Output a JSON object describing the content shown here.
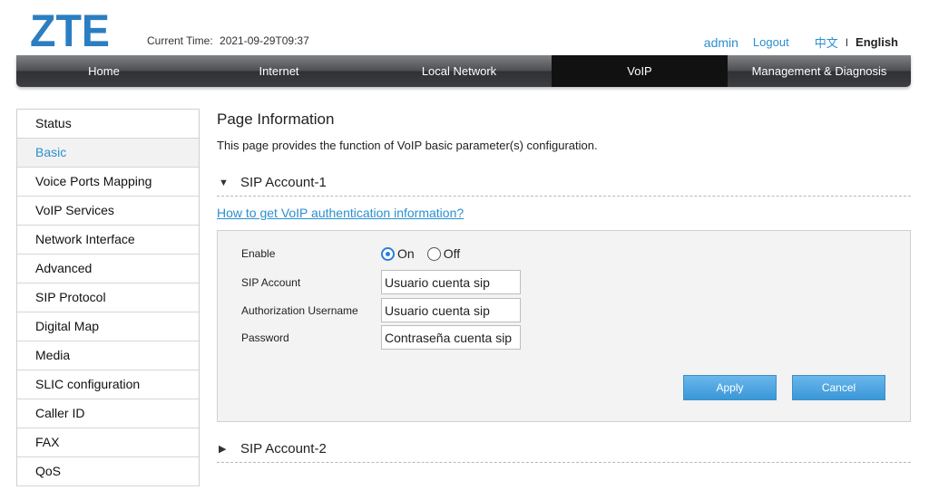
{
  "header": {
    "logo_text": "ZTE",
    "current_time_label": "Current Time:",
    "current_time_value": "2021-09-29T09:37",
    "user": "admin",
    "logout": "Logout",
    "lang_cn": "中文",
    "lang_sep": "I",
    "lang_en": "English"
  },
  "nav": [
    {
      "label": "Home",
      "active": false
    },
    {
      "label": "Internet",
      "active": false
    },
    {
      "label": "Local Network",
      "active": false
    },
    {
      "label": "VoIP",
      "active": true
    },
    {
      "label": "Management & Diagnosis",
      "active": false
    }
  ],
  "sidebar": [
    {
      "label": "Status"
    },
    {
      "label": "Basic",
      "active": true
    },
    {
      "label": "Voice Ports Mapping"
    },
    {
      "label": "VoIP Services"
    },
    {
      "label": "Network Interface"
    },
    {
      "label": "Advanced"
    },
    {
      "label": "SIP Protocol"
    },
    {
      "label": "Digital Map"
    },
    {
      "label": "Media"
    },
    {
      "label": "SLIC configuration"
    },
    {
      "label": "Caller ID"
    },
    {
      "label": "FAX"
    },
    {
      "label": "QoS"
    }
  ],
  "main": {
    "title": "Page Information",
    "description": "This page provides the function of VoIP basic parameter(s) configuration.",
    "section1": {
      "arrow": "▼",
      "title": "SIP Account-1"
    },
    "help_link": "How to get VoIP authentication information?",
    "form": {
      "enable_label": "Enable",
      "on_label": "On",
      "off_label": "Off",
      "enable_value": "On",
      "sip_account_label": "SIP Account",
      "sip_account_value": "Usuario cuenta sip",
      "auth_user_label": "Authorization Username",
      "auth_user_value": "Usuario cuenta sip",
      "password_label": "Password",
      "password_value": "Contraseña cuenta sip"
    },
    "apply_label": "Apply",
    "cancel_label": "Cancel",
    "section2": {
      "arrow": "▶",
      "title": "SIP Account-2"
    }
  },
  "colors": {
    "accent": "#2b8fd0",
    "logo": "#2b7ec1",
    "nav_active": "#111111"
  }
}
